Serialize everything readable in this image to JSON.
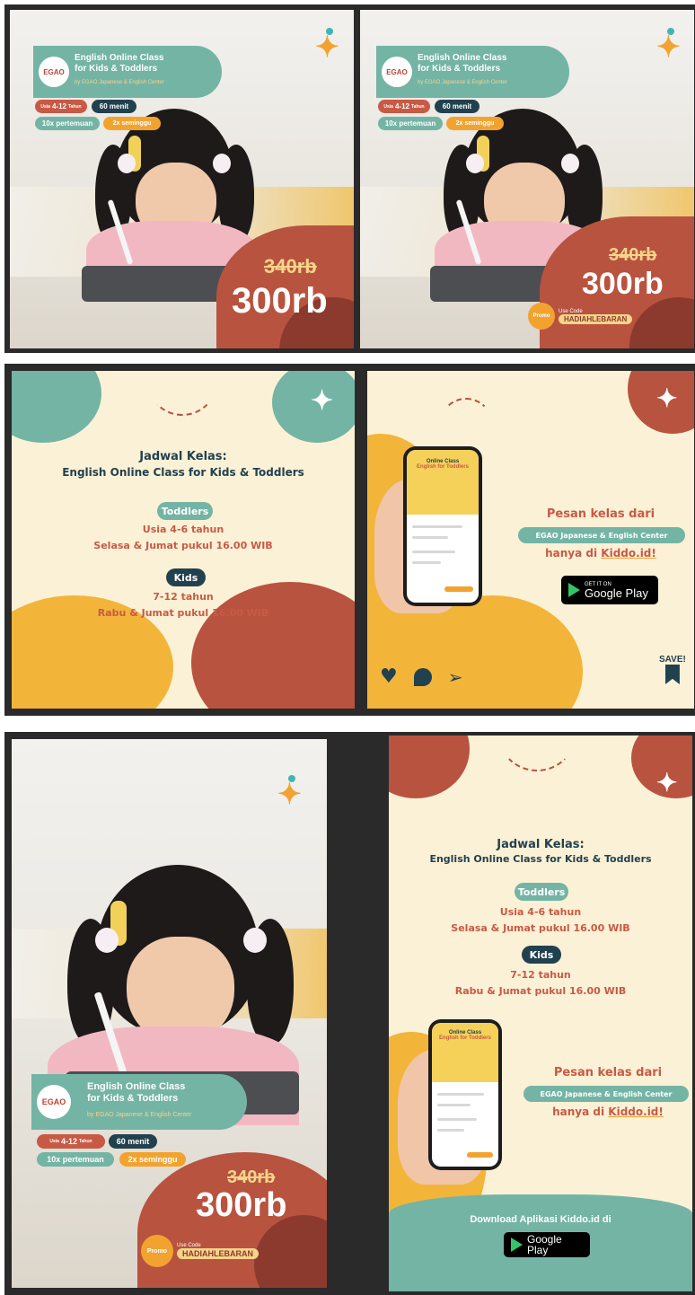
{
  "brand": {
    "kiddo_mark": "✦"
  },
  "colors": {
    "teal": "#74b4a5",
    "terracotta": "#b8533f",
    "navy": "#22414f",
    "orange": "#f2a32f",
    "cream": "#fbf1d6",
    "yellow": "#f6d48a"
  },
  "promo_card": {
    "title_line1": "English Online Class",
    "title_line2": "for Kids & Toddlers",
    "subtitle": "by EGAO Japanese & English Center",
    "logo": "EGAO",
    "pills": {
      "age_prefix": "Usia",
      "age": "4-12",
      "age_suffix": "Tahun",
      "duration": "60 menit",
      "sessions": "10x pertemuan",
      "frequency": "2x seminggu"
    },
    "old_price": "340rb",
    "new_price": "300rb",
    "code_label": "Use Code",
    "code": "HADIAHLEBARAN",
    "badge": "Promo"
  },
  "schedule": {
    "title_line1": "Jadwal Kelas:",
    "title_line2": "English Online Class for Kids & Toddlers",
    "toddlers_label": "Toddlers",
    "toddlers_age": "Usia 4-6 tahun",
    "toddlers_time": "Selasa & Jumat pukul 16.00 WIB",
    "kids_label": "Kids",
    "kids_age": "7-12 tahun",
    "kids_time": "Rabu & Jumat pukul 16.00 WIB"
  },
  "app": {
    "screen_title": "Online Class",
    "screen_sub": "English for Toddlers",
    "cta_line1": "Pesan kelas dari",
    "cta_chip": "EGAO Japanese & English Center",
    "cta_line3_prefix": "hanya di ",
    "cta_line3_link": "Kiddo.id!",
    "gplay_small": "GET IT ON",
    "gplay_big": "Google Play",
    "save_label": "SAVE!",
    "download_label": "Download Aplikasi Kiddo.id di"
  }
}
